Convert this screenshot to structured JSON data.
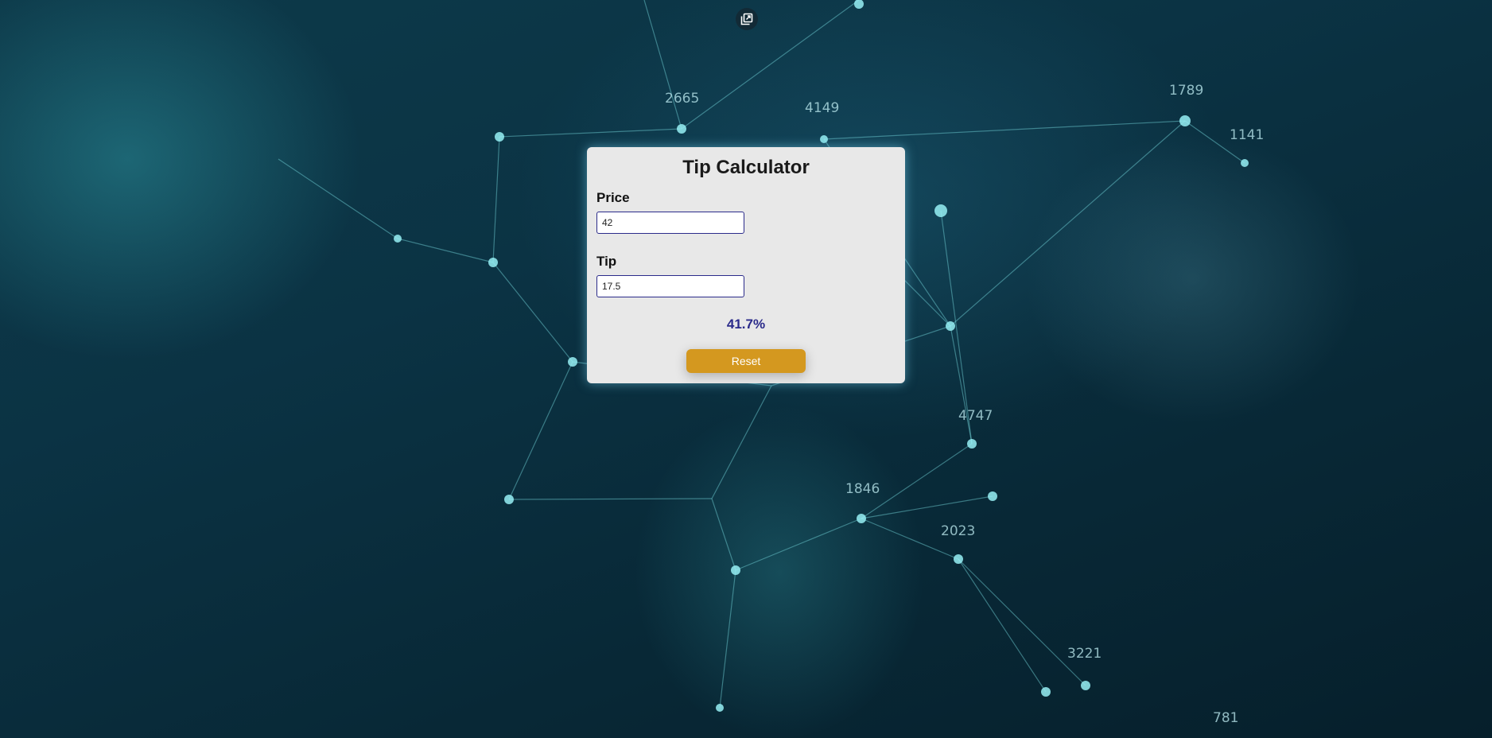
{
  "app": {
    "title": "Tip Calculator"
  },
  "form": {
    "price": {
      "label": "Price",
      "value": "42"
    },
    "tip": {
      "label": "Tip",
      "value": "17.5"
    },
    "result": "41.7%",
    "reset_label": "Reset"
  },
  "background": {
    "labels": [
      "2665",
      "1789",
      "1141",
      "4149",
      "4747",
      "1846",
      "2023",
      "3221",
      "781"
    ]
  },
  "icons": {
    "popout": "popout-icon"
  },
  "colors": {
    "card_bg": "#e8e8e8",
    "input_border": "#2b2b8a",
    "result_text": "#2a2a8a",
    "reset_button": "#d4981f"
  }
}
